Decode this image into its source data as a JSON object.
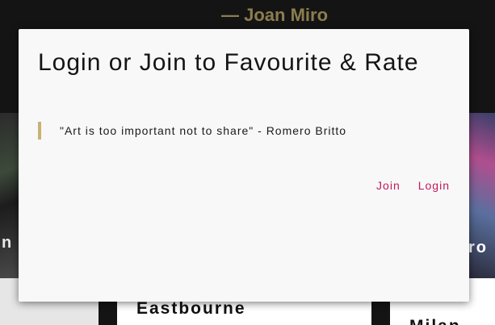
{
  "background": {
    "attribution": "— Joan Miro",
    "left_card_fragment": "n",
    "right_card_fragment": "ro",
    "cities": [
      "Eastbourne",
      "Milan"
    ]
  },
  "modal": {
    "title": "Login or Join to Favourite & Rate",
    "quote": "\"Art is too important not to share\" - Romero Britto",
    "join_label": "Join",
    "login_label": "Login"
  },
  "colors": {
    "accent_link": "#c2185b",
    "quote_bar": "#c8b273",
    "attribution": "#8b7d4e"
  }
}
